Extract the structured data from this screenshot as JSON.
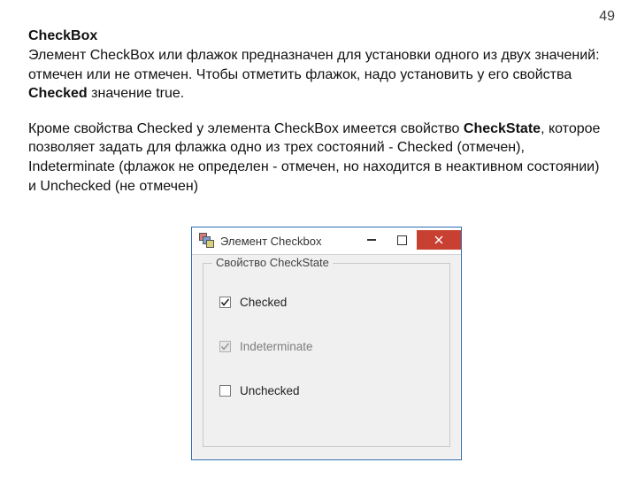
{
  "page_number": "49",
  "heading": "CheckBox",
  "para1_a": "Элемент CheckBox или флажок предназначен для установки одного из двух значений: отмечен или не отмечен. Чтобы отметить флажок, надо установить у его свойства  ",
  "para1_bold": "Checked",
  "para1_b": " значение true.",
  "para2_a": "Кроме свойства Checked у элемента CheckBox имеется свойство ",
  "para2_bold": "CheckState",
  "para2_b": ", которое позволяет задать для флажка одно из трех состояний - Checked (отмечен), Indeterminate (флажок не определен - отмечен, но находится в неактивном состоянии) и Unchecked (не отмечен)",
  "window": {
    "title": "Элемент Checkbox",
    "group_title": "Свойство CheckState",
    "items": {
      "checked": "Checked",
      "indeterminate": "Indeterminate",
      "unchecked": "Unchecked"
    }
  }
}
